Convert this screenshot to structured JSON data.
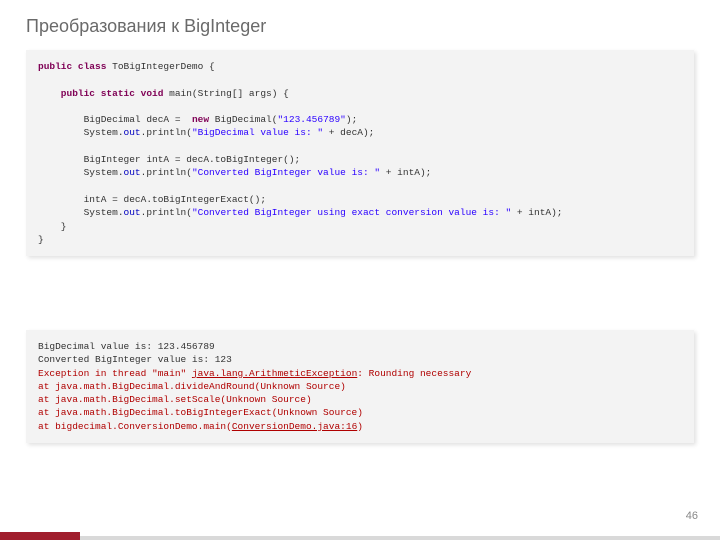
{
  "title": "Преобразования к BigInteger",
  "page_number": "46",
  "code1": {
    "l1a": "public class",
    "l1b": " ToBigIntegerDemo {",
    "l2a": "    public static void",
    "l2b": " main(String[] args) {",
    "l3a": "        BigDecimal decA =  ",
    "l3b": "new",
    "l3c": " BigDecimal(",
    "l3d": "\"123.456789\"",
    "l3e": ");",
    "l4a": "        System.",
    "l4b": "out",
    "l4c": ".println(",
    "l4d": "\"BigDecimal value is: \"",
    "l4e": " + decA);",
    "l5a": "        BigInteger intA = decA.toBigInteger();",
    "l6a": "        System.",
    "l6b": "out",
    "l6c": ".println(",
    "l6d": "\"Converted BigInteger value is: \"",
    "l6e": " + intA);",
    "l7a": "        intA = decA.toBigIntegerExact();",
    "l8a": "        System.",
    "l8b": "out",
    "l8c": ".println(",
    "l8d": "\"Converted BigInteger using exact conversion value is: \"",
    "l8e": " + intA);",
    "l9": "    }",
    "l10": "}"
  },
  "output": {
    "o1": "BigDecimal value is: 123.456789",
    "o2": "Converted BigInteger value is: 123",
    "e1a": "Exception in thread \"main\" ",
    "e1b": "java.lang.ArithmeticException",
    "e1c": ": Rounding necessary",
    "e2": "at java.math.BigDecimal.divideAndRound(Unknown Source)",
    "e3": "at java.math.BigDecimal.setScale(Unknown Source)",
    "e4": "at java.math.BigDecimal.toBigIntegerExact(Unknown Source)",
    "e5a": "at bigdecimal.ConversionDemo.main(",
    "e5b": "ConversionDemo.java:16",
    "e5c": ")"
  }
}
